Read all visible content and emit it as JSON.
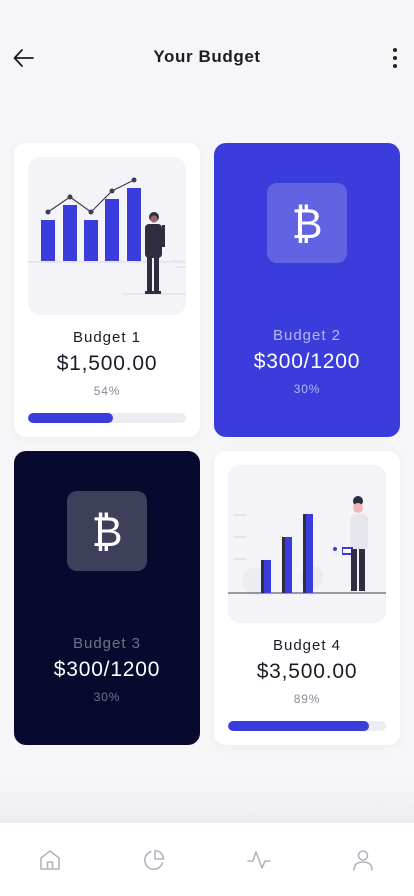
{
  "header": {
    "title": "Your Budget",
    "back_icon": "arrow-left-icon",
    "menu_icon": "more-vertical-icon"
  },
  "colors": {
    "accent": "#3a3ddb",
    "navy": "#070a2e",
    "track": "#ececf3"
  },
  "budgets": [
    {
      "name": "Budget 1",
      "amount": "$1,500.00",
      "percent": "54%",
      "progress": 0.54,
      "style": "white",
      "illustration": "growth-chart-illustration"
    },
    {
      "name": "Budget 2",
      "amount": "$300/1200",
      "percent": "30%",
      "style": "blue",
      "icon": "bitcoin-icon",
      "symbol": "₿"
    },
    {
      "name": "Budget 3",
      "amount": "$300/1200",
      "percent": "30%",
      "style": "navy",
      "icon": "bitcoin-icon",
      "symbol": "₿"
    },
    {
      "name": "Budget 4",
      "amount": "$3,500.00",
      "percent": "89%",
      "progress": 0.89,
      "style": "white",
      "illustration": "bar-chart-woman-illustration"
    }
  ],
  "tabbar": {
    "items": [
      {
        "icon": "home-icon"
      },
      {
        "icon": "pie-chart-icon"
      },
      {
        "icon": "activity-icon"
      },
      {
        "icon": "profile-icon"
      }
    ]
  }
}
